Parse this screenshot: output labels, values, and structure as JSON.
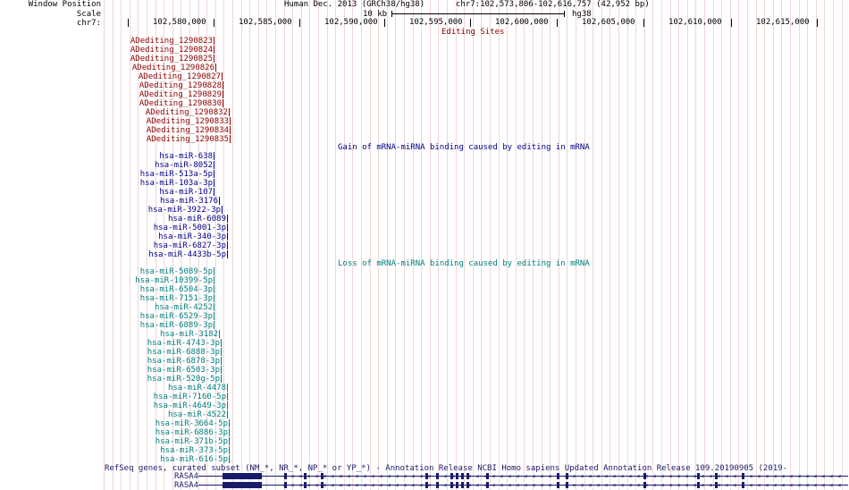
{
  "header": {
    "window_position_label": "Window Position",
    "scale_label": "Scale",
    "chrom_label": "chr7:",
    "assembly_text": "Human Dec. 2013 (GRCh38/hg38)",
    "position_text": "chr7:102,573,806-102,616,757 (42,952 bp)",
    "scale_text": "10 kb",
    "scale_assembly": "hg38",
    "positions": [
      "102,580,000",
      "102,585,000",
      "102,590,000",
      "102,595,000",
      "102,600,000",
      "102,605,000",
      "102,610,000",
      "102,615,000"
    ]
  },
  "tracks": {
    "editing_sites": {
      "title": "Editing Sites",
      "color": "#8b0000",
      "items": [
        "ADediting_1290823",
        "ADediting_1290824",
        "ADediting_1290825",
        "ADediting_1290826",
        "ADediting_1290827",
        "ADediting_1290828",
        "ADediting_1290829",
        "ADediting_1290830",
        "ADediting_1290832",
        "ADediting_1290833",
        "ADediting_1290834",
        "ADediting_1290835"
      ]
    },
    "gain": {
      "title": "Gain of mRNA-miRNA binding caused by editing in mRNA",
      "color": "#00008b",
      "items": [
        "hsa-miR-638",
        "hsa-miR-8052",
        "hsa-miR-513a-5p",
        "hsa-miR-103a-3p",
        "hsa-miR-107",
        "hsa-miR-3176",
        "hsa-miR-3922-3p",
        "hsa-miR-6089",
        "hsa-miR-5001-3p",
        "hsa-miR-340-3p",
        "hsa-miR-6827-3p",
        "hsa-miR-4433b-5p"
      ]
    },
    "loss": {
      "title": "Loss of mRNA-miRNA binding caused by editing in mRNA",
      "color": "#008080",
      "items": [
        "hsa-miR-5089-5p",
        "hsa-miR-10399-5p",
        "hsa-miR-6504-3p",
        "hsa-miR-7151-3p",
        "hsa-miR-4252",
        "hsa-miR-6529-3p",
        "hsa-miR-6889-3p",
        "hsa-miR-3182",
        "hsa-miR-4743-3p",
        "hsa-miR-6888-3p",
        "hsa-miR-6878-3p",
        "hsa-miR-6503-3p",
        "hsa-miR-520g-5p",
        "hsa-miR-4478",
        "hsa-miR-7160-5p",
        "hsa-miR-4649-3p",
        "hsa-miR-4522",
        "hsa-miR-3664-5p",
        "hsa-miR-6886-3p",
        "hsa-miR-371b-5p",
        "hsa-miR-373-5p",
        "hsa-miR-616-5p"
      ]
    },
    "refseq": {
      "title": "RefSeq genes, curated subset (NM_*, NR_*, NP_* or YP_*) - Annotation Release NCBI Homo sapiens Updated Annotation Release 109.20190905 (2019-",
      "color": "#1a1a6a",
      "genes": [
        "RASA4",
        "RASA4"
      ]
    }
  }
}
